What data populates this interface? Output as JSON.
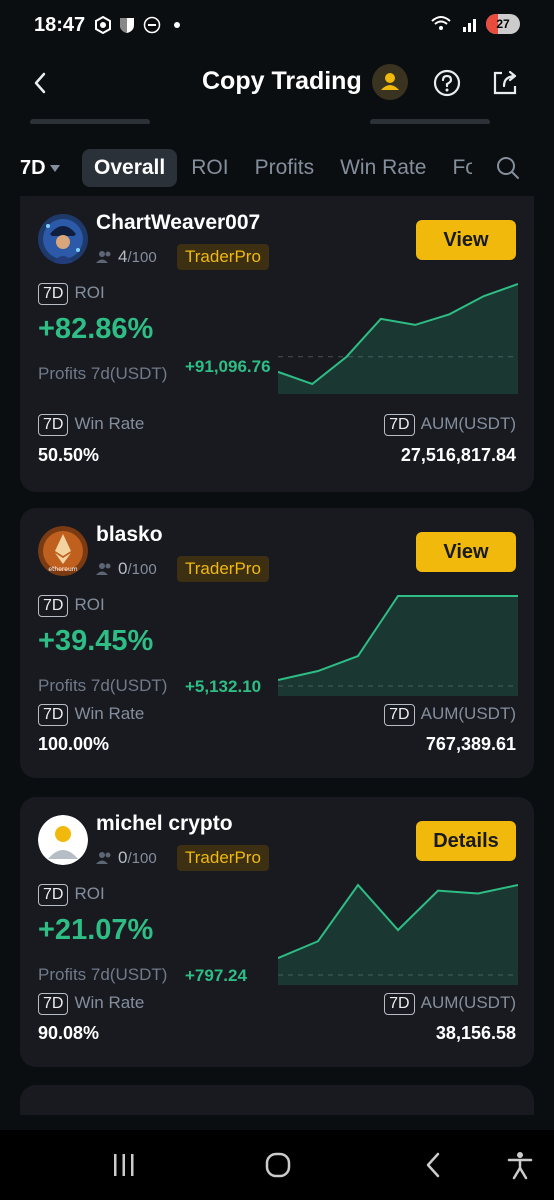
{
  "status_bar": {
    "time": "18:47",
    "battery": "27"
  },
  "header": {
    "title": "Copy Trading"
  },
  "filters": {
    "period": "7D",
    "tabs": [
      {
        "label": "Overall",
        "active": true
      },
      {
        "label": "ROI",
        "active": false
      },
      {
        "label": "Profits",
        "active": false
      },
      {
        "label": "Win Rate",
        "active": false
      },
      {
        "label": "Fo",
        "active": false
      }
    ]
  },
  "labels": {
    "period_pill": "7D",
    "roi": "ROI",
    "profits": "Profits 7d(USDT)",
    "win_rate": "Win Rate",
    "aum": "AUM(USDT)"
  },
  "traders": [
    {
      "name": "ChartWeaver007",
      "followers": "4",
      "max_followers": "/100",
      "badge": "TraderPro",
      "button": "View",
      "roi": "+82.86%",
      "profits": "+91,096.76",
      "win_rate": "50.50%",
      "aum": "27,516,817.84",
      "sparkline": [
        -10,
        -18,
        0,
        25,
        21,
        28,
        40,
        48
      ]
    },
    {
      "name": "blasko",
      "followers": "0",
      "max_followers": "/100",
      "badge": "TraderPro",
      "button": "View",
      "roi": "+39.45%",
      "profits": "+5,132.10",
      "win_rate": "100.00%",
      "aum": "767,389.61",
      "sparkline": [
        2,
        5,
        10,
        30,
        30,
        30,
        30
      ]
    },
    {
      "name": "michel crypto",
      "followers": "0",
      "max_followers": "/100",
      "badge": "TraderPro",
      "button": "Details",
      "roi": "+21.07%",
      "profits": "+797.24",
      "win_rate": "90.08%",
      "aum": "38,156.58",
      "sparkline": [
        3,
        6,
        16,
        8,
        15,
        14.5,
        16
      ]
    }
  ],
  "colors": {
    "accent": "#f0b90b",
    "positive": "#2ebd85",
    "negative": "#f6465d",
    "background": "#0b0e11",
    "card": "#181a20"
  }
}
